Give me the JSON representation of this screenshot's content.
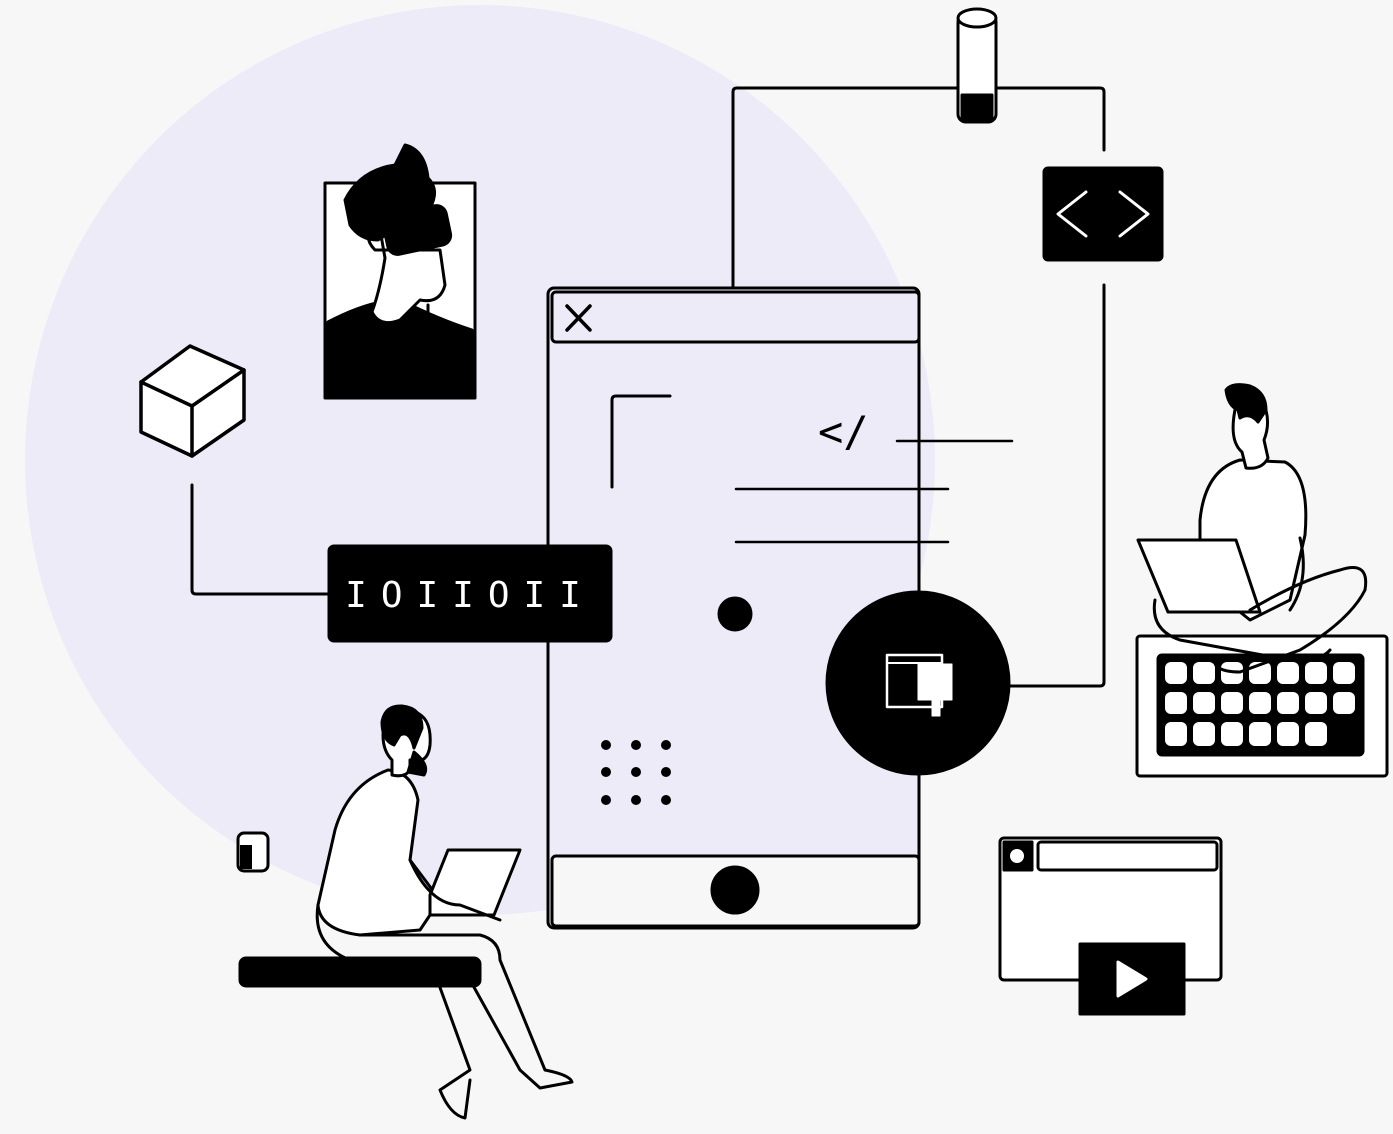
{
  "palette": {
    "background": "#f7f7f7",
    "blob": "#edebf7",
    "ink": "#000000",
    "paper": "#ffffff"
  },
  "illustration": {
    "binary_label": "IOIIOII",
    "code_tag_label": "</",
    "tag_glyphs": "< >",
    "icons": [
      "close-icon",
      "cube-icon",
      "database-icon",
      "code-brackets-icon",
      "design-brush-icon",
      "play-icon",
      "grid-dots-icon"
    ]
  }
}
